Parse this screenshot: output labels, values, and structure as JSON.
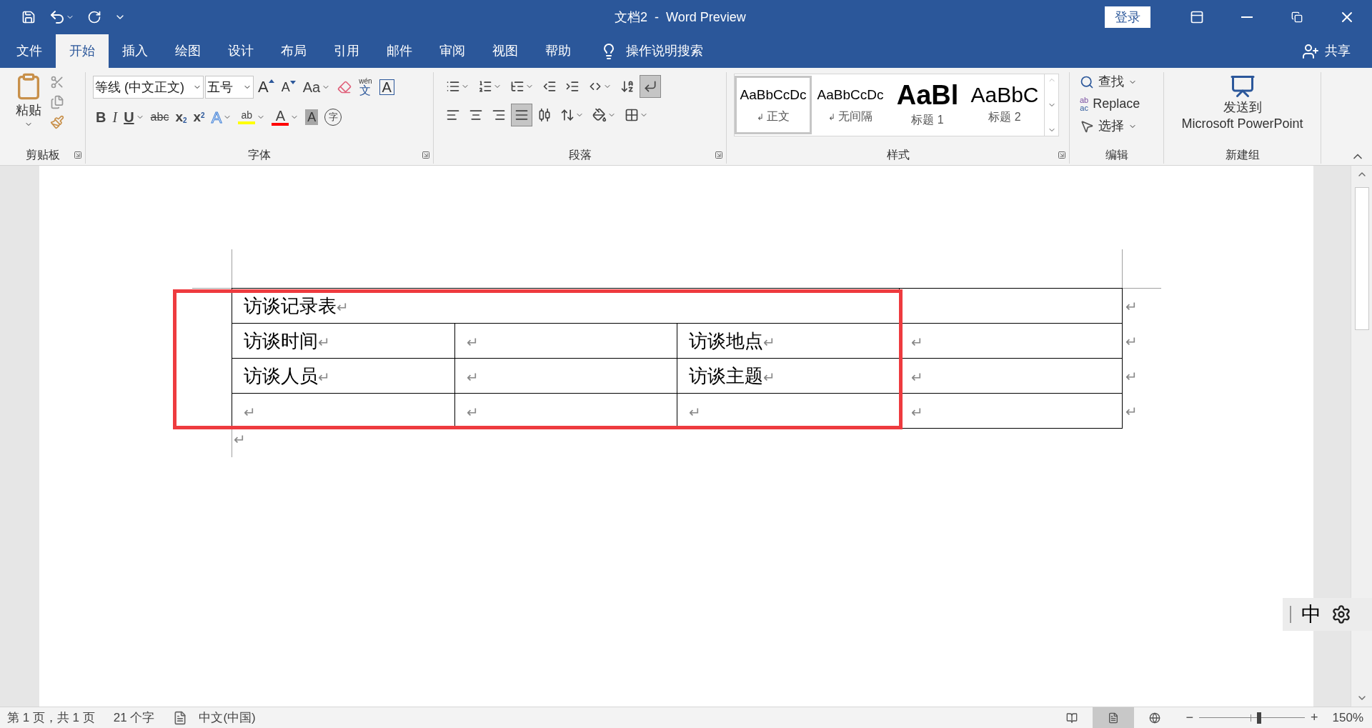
{
  "window": {
    "title": "文档2  -  Word Preview",
    "login": "登录"
  },
  "tabs": [
    {
      "label": "文件",
      "selected": false
    },
    {
      "label": "开始",
      "selected": true
    },
    {
      "label": "插入",
      "selected": false
    },
    {
      "label": "绘图",
      "selected": false
    },
    {
      "label": "设计",
      "selected": false
    },
    {
      "label": "布局",
      "selected": false
    },
    {
      "label": "引用",
      "selected": false
    },
    {
      "label": "邮件",
      "selected": false
    },
    {
      "label": "审阅",
      "selected": false
    },
    {
      "label": "视图",
      "selected": false
    },
    {
      "label": "帮助",
      "selected": false
    }
  ],
  "tell_me": "操作说明搜索",
  "share": "共享",
  "ribbon": {
    "clipboard": {
      "paste": "粘贴",
      "label": "剪贴板"
    },
    "font": {
      "label": "字体",
      "font_name": "等线 (中文正文)",
      "font_size": "五号",
      "row1": [
        {
          "kind": "grow",
          "label": "A"
        },
        {
          "kind": "shrink",
          "label": "A"
        },
        {
          "kind": "case",
          "label": "Aa",
          "menu": true
        },
        {
          "kind": "clear"
        },
        {
          "kind": "phonetic",
          "label": "wén",
          "sub": "文"
        },
        {
          "kind": "boxed",
          "label": "A"
        }
      ],
      "row2": [
        {
          "kind": "bold",
          "label": "B"
        },
        {
          "kind": "italic",
          "label": "I"
        },
        {
          "kind": "underline",
          "label": "U",
          "menu": true
        },
        {
          "kind": "strike",
          "label": "abc"
        },
        {
          "kind": "subscript",
          "label": "x",
          "script": "2"
        },
        {
          "kind": "superscript",
          "label": "x",
          "script": "2"
        },
        {
          "kind": "effects",
          "label": "A",
          "menu": true
        },
        {
          "kind": "highlight",
          "label": "ab",
          "menu": true
        },
        {
          "kind": "fontcolor",
          "label": "A",
          "menu": true
        },
        {
          "kind": "shading",
          "label": "A"
        },
        {
          "kind": "enclose",
          "label": "字"
        }
      ]
    },
    "paragraph": {
      "label": "段落",
      "row1": [
        {
          "kind": "bullets",
          "menu": true,
          "selected": false
        },
        {
          "kind": "numbering",
          "menu": true,
          "selected": false
        },
        {
          "kind": "multilevel",
          "menu": true,
          "selected": false
        },
        {
          "kind": "outdent",
          "menu": false,
          "selected": false
        },
        {
          "kind": "indent",
          "menu": false,
          "selected": false
        },
        {
          "kind": "asian",
          "menu": true,
          "selected": false
        },
        {
          "kind": "sort",
          "menu": false,
          "selected": false
        },
        {
          "kind": "marks",
          "menu": false,
          "selected": true
        }
      ],
      "row2": [
        {
          "kind": "left",
          "menu": false,
          "selected": false
        },
        {
          "kind": "center",
          "menu": false,
          "selected": false
        },
        {
          "kind": "right",
          "menu": false,
          "selected": false
        },
        {
          "kind": "justify",
          "menu": false,
          "selected": true
        },
        {
          "kind": "distribute",
          "menu": false,
          "selected": false
        },
        {
          "kind": "spacing",
          "menu": true,
          "selected": false
        },
        {
          "kind": "fill",
          "menu": true,
          "selected": false
        },
        {
          "kind": "borders",
          "menu": true,
          "selected": false
        }
      ]
    },
    "styles": {
      "label": "样式",
      "items": [
        {
          "preview": "AaBbCcDc",
          "name": "正文",
          "mark": "↲",
          "kind": "normal",
          "selected": true
        },
        {
          "preview": "AaBbCcDc",
          "name": "无间隔",
          "mark": "↲",
          "kind": "normal",
          "selected": false
        },
        {
          "preview": "AaBl",
          "name": "标题 1",
          "kind": "heading1",
          "selected": false
        },
        {
          "preview": "AaBbC",
          "name": "标题 2",
          "kind": "heading2",
          "selected": false
        }
      ]
    },
    "editing": {
      "label": "编辑",
      "find": "查找",
      "replace": "Replace",
      "replace_icon_top": "ab",
      "replace_icon_bottom": "ac",
      "select": "选择"
    },
    "new_group": {
      "label": "新建组",
      "send_line1": "发送到",
      "send_line2": "Microsoft PowerPoint"
    }
  },
  "document": {
    "highlight_frame": true,
    "table": [
      {
        "cells": [
          {
            "text": "访谈记录表",
            "mark": "↵"
          },
          {}
        ],
        "end_mark": "↵"
      },
      {
        "cells": [
          {
            "text": "访谈时间",
            "mark": "↵"
          },
          {
            "mark": "↵"
          },
          {
            "text": "访谈地点",
            "mark": "↵"
          },
          {
            "mark": "↵"
          }
        ],
        "end_mark": "↵"
      },
      {
        "cells": [
          {
            "text": "访谈人员",
            "mark": "↵"
          },
          {
            "mark": "↵"
          },
          {
            "text": "访谈主题",
            "mark": "↵"
          },
          {
            "mark": "↵"
          }
        ],
        "end_mark": "↵"
      },
      {
        "cells": [
          {
            "mark": "↵"
          },
          {
            "mark": "↵"
          },
          {
            "mark": "↵"
          },
          {
            "mark": "↵"
          }
        ],
        "end_mark": "↵"
      }
    ],
    "after_mark": "↵"
  },
  "ime": {
    "mode": "中"
  },
  "status_bar": {
    "page": "第 1 页，共 1 页",
    "words": "21 个字",
    "language": "中文(中国)",
    "views": [
      {
        "kind": "read",
        "selected": false
      },
      {
        "kind": "print",
        "selected": true
      },
      {
        "kind": "web",
        "selected": false
      }
    ],
    "zoom_out": "−",
    "zoom_in": "+",
    "zoom": {
      "level": 0.57
    },
    "zoom_text": "150%"
  }
}
